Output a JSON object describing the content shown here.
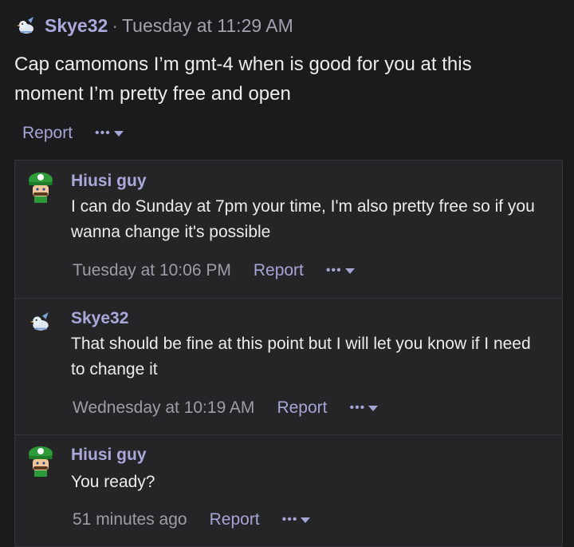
{
  "post": {
    "username": "Skye32",
    "separator": "·",
    "timestamp": "Tuesday at 11:29 AM",
    "body": "Cap camomons I’m gmt-4 when is good for you at this moment I’m pretty free and open",
    "report_label": "Report",
    "more_label": "•••"
  },
  "replies": [
    {
      "username": "Hiusi guy",
      "avatar": "green-cap-character-icon",
      "text": "I can do Sunday at 7pm your time, I'm also pretty free so if you wanna change it's possible",
      "timestamp": "Tuesday at 10:06 PM",
      "report_label": "Report",
      "more_label": "•••"
    },
    {
      "username": "Skye32",
      "avatar": "bird-icon",
      "text": "That should be fine at this point but I will let you know if I need to change it",
      "timestamp": "Wednesday at 10:19 AM",
      "report_label": "Report",
      "more_label": "•••"
    },
    {
      "username": "Hiusi guy",
      "avatar": "green-cap-character-icon",
      "text": "You ready?",
      "timestamp": "51 minutes ago",
      "report_label": "Report",
      "more_label": "•••"
    }
  ],
  "colors": {
    "background": "#1b1b1d",
    "reply_background": "#252527",
    "username": "#a9a9dc",
    "link": "#a5a5d6",
    "muted": "#9d9da8",
    "text": "#ececec"
  }
}
